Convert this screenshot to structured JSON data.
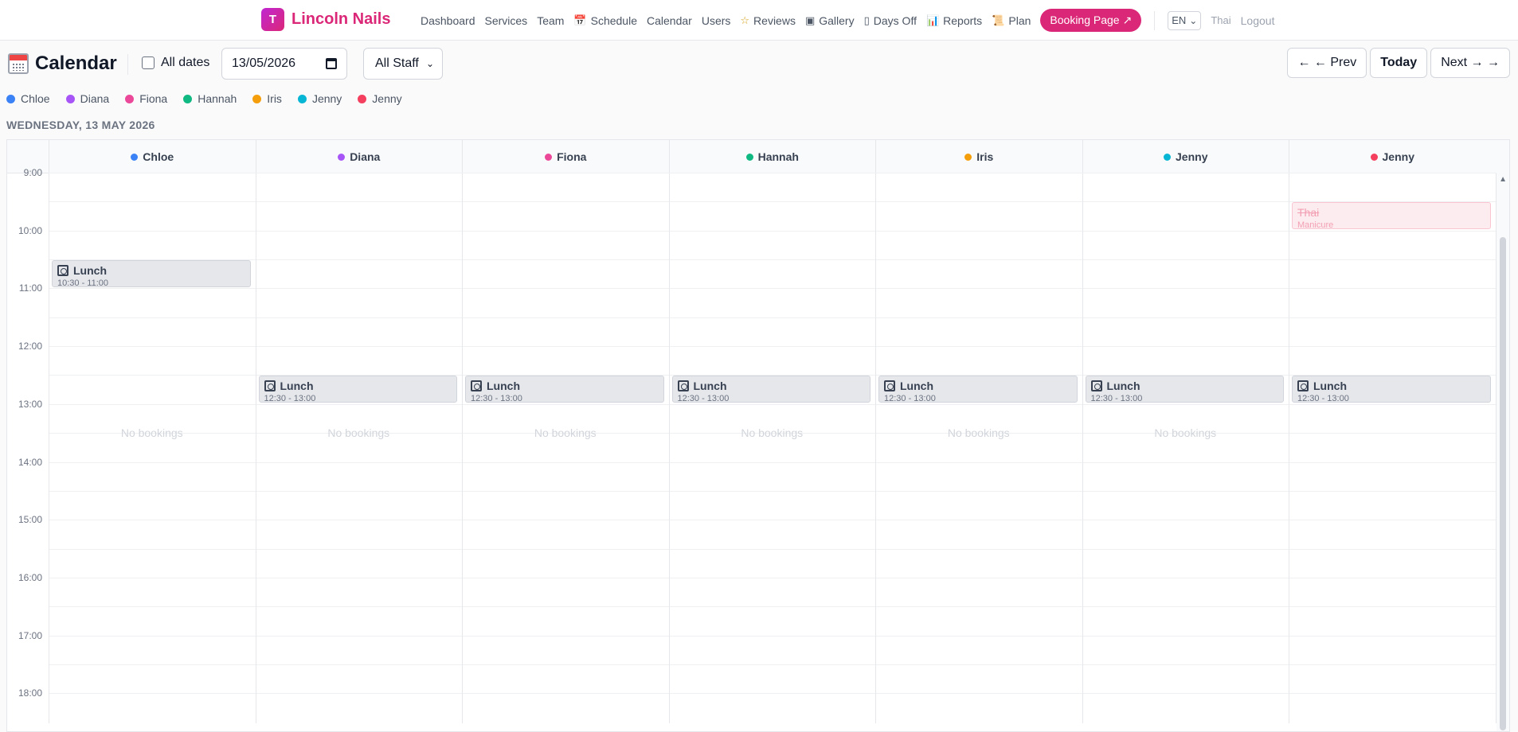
{
  "nav": {
    "brand_initial": "T",
    "brand_name": "Lincoln Nails",
    "links": [
      {
        "label": "Dashboard",
        "icon": ""
      },
      {
        "label": "Services",
        "icon": ""
      },
      {
        "label": "Team",
        "icon": ""
      },
      {
        "label": "Schedule",
        "icon": "calendar-icon"
      },
      {
        "label": "Calendar",
        "icon": ""
      },
      {
        "label": "Users",
        "icon": ""
      },
      {
        "label": "Reviews",
        "icon": "star-icon"
      },
      {
        "label": "Gallery",
        "icon": "picture-icon"
      },
      {
        "label": "Days Off",
        "icon": "calendar-one-icon"
      },
      {
        "label": "Reports",
        "icon": "bar-chart-icon"
      },
      {
        "label": "Plan",
        "icon": "scroll-icon"
      }
    ],
    "booking_button": "Booking Page ↗",
    "language": "EN",
    "user": "Thai",
    "logout": "Logout"
  },
  "toolbar": {
    "title": "Calendar",
    "all_dates_label": "All dates",
    "all_dates_checked": false,
    "date_value": "13/05/2026",
    "staff_filter": "All Staff",
    "prev_label": "← ← Prev",
    "today_label": "Today",
    "next_label": "Next → →"
  },
  "date_heading": "WEDNESDAY, 13 MAY 2026",
  "staff": [
    {
      "name": "Chloe",
      "color": "#3b82f6"
    },
    {
      "name": "Diana",
      "color": "#a855f7"
    },
    {
      "name": "Fiona",
      "color": "#ec4899"
    },
    {
      "name": "Hannah",
      "color": "#10b981"
    },
    {
      "name": "Iris",
      "color": "#f59e0b"
    },
    {
      "name": "Jenny",
      "color": "#06b6d4"
    },
    {
      "name": "Jenny",
      "color": "#f43f5e"
    }
  ],
  "hours": [
    "9:00",
    "10:00",
    "11:00",
    "12:00",
    "13:00",
    "14:00",
    "15:00",
    "16:00",
    "17:00",
    "18:00"
  ],
  "events": [
    {
      "staff_index": 0,
      "title": "Lunch",
      "time": "10:30 - 11:00",
      "kind": "break"
    },
    {
      "staff_index": 1,
      "title": "Lunch",
      "time": "12:30 - 13:00",
      "kind": "break"
    },
    {
      "staff_index": 2,
      "title": "Lunch",
      "time": "12:30 - 13:00",
      "kind": "break"
    },
    {
      "staff_index": 3,
      "title": "Lunch",
      "time": "12:30 - 13:00",
      "kind": "break"
    },
    {
      "staff_index": 4,
      "title": "Lunch",
      "time": "12:30 - 13:00",
      "kind": "break"
    },
    {
      "staff_index": 5,
      "title": "Lunch",
      "time": "12:30 - 13:00",
      "kind": "break"
    },
    {
      "staff_index": 6,
      "title": "Lunch",
      "time": "12:30 - 13:00",
      "kind": "break"
    },
    {
      "staff_index": 6,
      "title": "Thai",
      "time": "Manicure",
      "kind": "cancelled"
    }
  ],
  "no_bookings_text": "No bookings",
  "no_bookings_columns": [
    0,
    1,
    2,
    3,
    4,
    5
  ]
}
